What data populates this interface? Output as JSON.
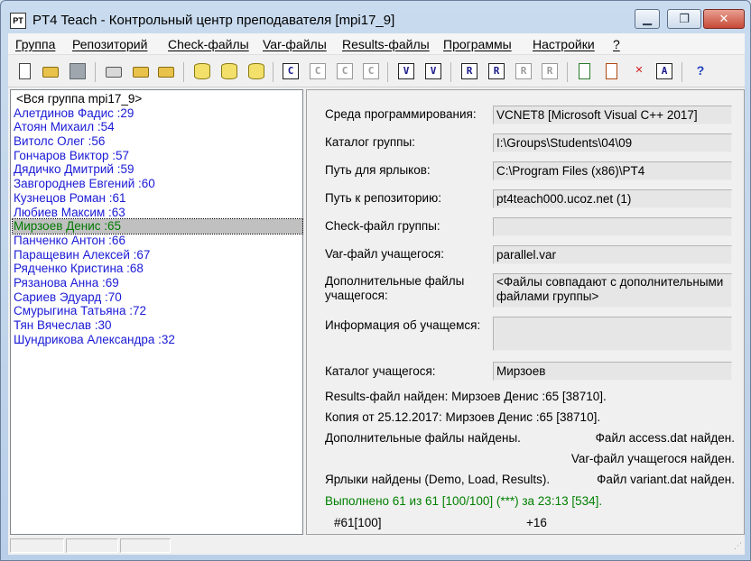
{
  "window": {
    "title": "PT4 Teach - Контрольный центр преподавателя [mpi17_9]",
    "icon": "PT",
    "min_glyph": "▁",
    "max_glyph": "❐",
    "close_glyph": "✕"
  },
  "menu": [
    "Группа",
    "Репозиторий",
    "Check-файлы",
    "Var-файлы",
    "Results-файлы",
    "Программы",
    "Настройки",
    "?"
  ],
  "toolbar": {
    "icons": [
      "new-document-icon",
      "open-folder-icon",
      "save-disk-icon",
      "scan-icon",
      "export-folder-icon",
      "import-folder-icon",
      "database-icon",
      "database-import-icon",
      "database-export-icon",
      "check-c-icon",
      "check-c-cancel-icon",
      "check-c-ok-icon",
      "check-c-copy-icon",
      "var-v-icon",
      "var-v-delete-icon",
      "results-r-icon",
      "results-r-view-icon",
      "results-r-copy-icon",
      "results-r-export-icon",
      "add-file-icon",
      "upload-file-icon",
      "delete-file-icon",
      "archive-a-icon",
      "help-icon"
    ],
    "glyphs": {
      "c": "C",
      "v": "V",
      "r": "R",
      "a": "A",
      "help": "?",
      "x": "✕"
    }
  },
  "students": [
    "<Вся группа mpi17_9>",
    "Алетдинов Фадис :29",
    "Атоян Михаил :54",
    "Витолс Олег :56",
    "Гончаров Виктор :57",
    "Дядичко Дмитрий :59",
    "Завгороднев Евгений :60",
    "Кузнецов Роман :61",
    "Любиев Максим :63",
    "Мирзоев Денис :65",
    "Панченко Антон :66",
    "Паращевин Алексей :67",
    "Рядченко Кристина :68",
    "Рязанова Анна :69",
    "Сариев Эдуард :70",
    "Смурыгина Татьяна :72",
    "Тян Вячеслав :30",
    "Шундрикова Александра :32"
  ],
  "selected_student": "Мирзоев Денис :65",
  "details": {
    "env_label": "Среда программирования:",
    "env_value": "VCNET8 [Microsoft Visual C++ 2017]",
    "group_dir_label": "Каталог группы:",
    "group_dir_value": "I:\\Groups\\Students\\04\\09",
    "shortcuts_path_label": "Путь для ярлыков:",
    "shortcuts_path_value": "C:\\Program Files (x86)\\PT4",
    "repo_path_label": "Путь к репозиторию:",
    "repo_path_value": "pt4teach000.ucoz.net (1)",
    "check_file_label": "Check-файл группы:",
    "check_file_value": "",
    "var_file_label": "Var-файл учащегося:",
    "var_file_value": "parallel.var",
    "extra_files_label": "Дополнительные файлы учащегося:",
    "extra_files_value": "<Файлы совпадают с дополнительными файлами группы>",
    "student_info_label": "Информация об учащемся:",
    "student_info_value": "",
    "student_dir_label": "Каталог учащегося:",
    "student_dir_value": "Мирзоев"
  },
  "status": {
    "results_found": "Results-файл найден: Мирзоев Денис :65 [38710].",
    "copy_from": "Копия от 25.12.2017: Мирзоев Денис :65 [38710].",
    "extra_found": "Дополнительные файлы найдены.",
    "access_found": "Файл access.dat найден.",
    "var_found": "Var-файл учащегося найден.",
    "shortcuts_found": "Ярлыки найдены (Demo, Load, Results).",
    "variant_found": "Файл variant.dat найден.",
    "completed": "Выполнено 61 из 61 [100/100] (***) за 23:13 [534].",
    "task_count": "#61[100]",
    "task_delta": "+16"
  },
  "colors": {
    "student_text": "#1a1ad6",
    "selected_text": "#007a00",
    "completed_text": "#008000"
  }
}
